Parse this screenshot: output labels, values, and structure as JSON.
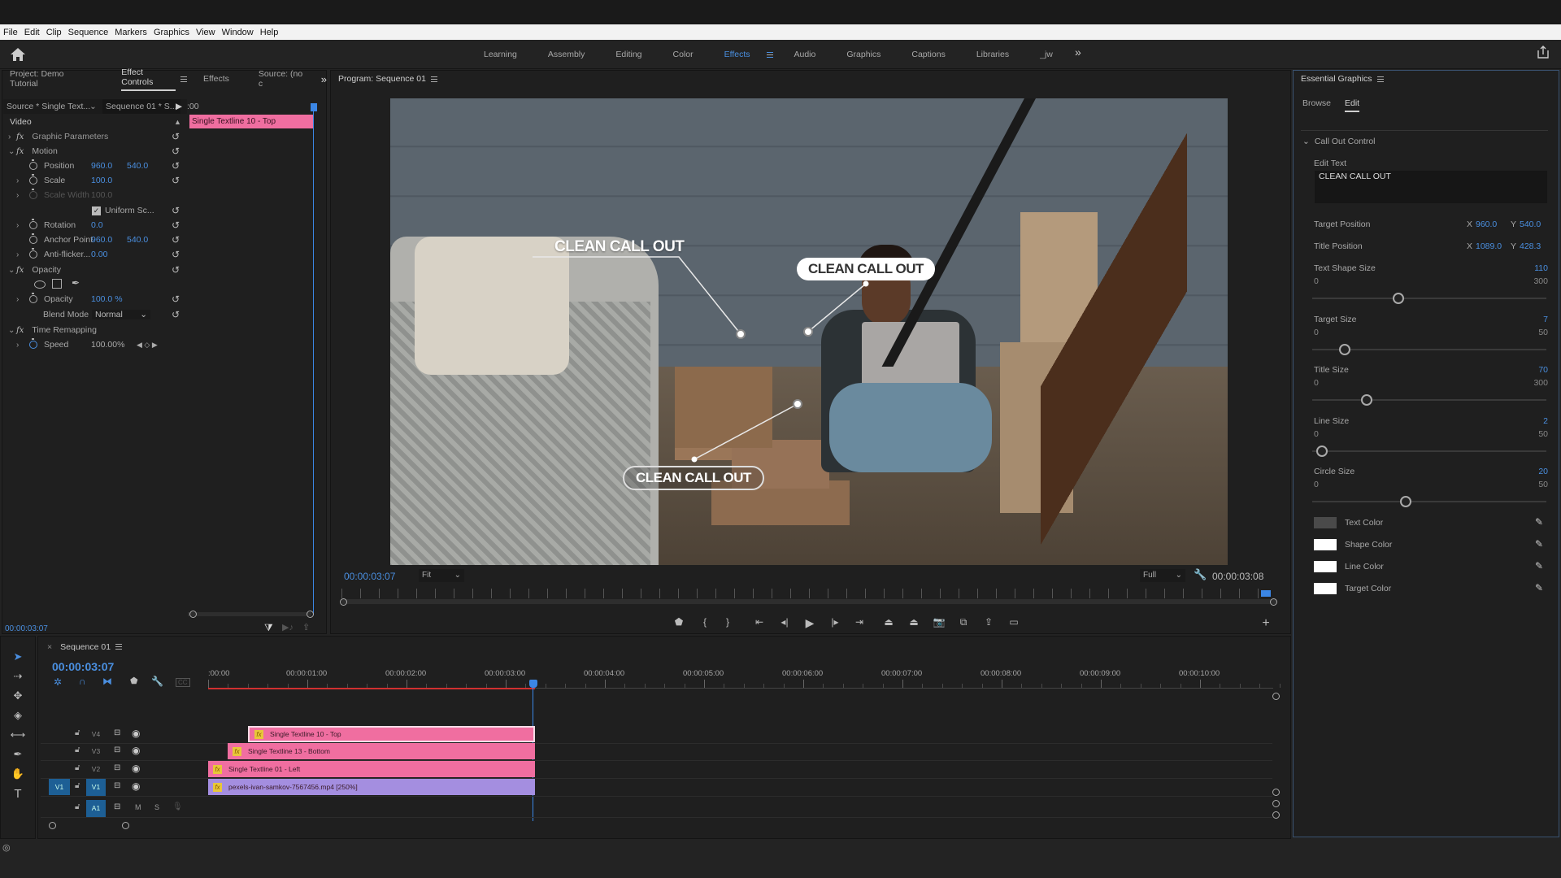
{
  "menu": [
    "File",
    "Edit",
    "Clip",
    "Sequence",
    "Markers",
    "Graphics",
    "View",
    "Window",
    "Help"
  ],
  "workspaces": {
    "items": [
      "Learning",
      "Assembly",
      "Editing",
      "Color",
      "Effects",
      "Audio",
      "Graphics",
      "Captions",
      "Libraries",
      "_jw"
    ],
    "active": "Effects",
    "more": "»"
  },
  "left_panel": {
    "tabs": [
      "Project: Demo Tutorial",
      "Effect Controls",
      "Effects",
      "Source: (no c"
    ],
    "active_tab": "Effect Controls",
    "more": "»",
    "source_label": "Source * Single Text...",
    "sequence_label": "Sequence 01 * S...",
    "mini_time": ":00",
    "clip_label": "Single Textline 10 - Top",
    "section": "Video",
    "properties": {
      "graphic_parameters": "Graphic Parameters",
      "motion": "Motion",
      "position_label": "Position",
      "position_x": "960.0",
      "position_y": "540.0",
      "scale_label": "Scale",
      "scale": "100.0",
      "scale_width_label": "Scale Width",
      "scale_width": "100.0",
      "uniform_scale_label": "Uniform Sc...",
      "uniform_scale_checked": true,
      "rotation_label": "Rotation",
      "rotation": "0.0",
      "anchor_label": "Anchor Point",
      "anchor_x": "960.0",
      "anchor_y": "540.0",
      "antiflicker_label": "Anti-flicker...",
      "antiflicker": "0.00",
      "opacity_section": "Opacity",
      "opacity_label": "Opacity",
      "opacity": "100.0 %",
      "blend_label": "Blend Mode",
      "blend": "Normal",
      "time_remap": "Time Remapping",
      "speed_label": "Speed",
      "speed": "100.00%"
    },
    "timecode": "00:00:03:07"
  },
  "program": {
    "title": "Program: Sequence 01",
    "timecode": "00:00:03:07",
    "fit": "Fit",
    "quality": "Full",
    "duration": "00:00:03:08",
    "callouts": [
      "CLEAN CALL OUT",
      "CLEAN CALL OUT",
      "CLEAN CALL OUT"
    ]
  },
  "essential_graphics": {
    "title": "Essential Graphics",
    "tabs": [
      "Browse",
      "Edit"
    ],
    "active_tab": "Edit",
    "section": "Call Out Control",
    "edit_text_label": "Edit Text",
    "edit_text_value": "CLEAN CALL OUT",
    "target_position": {
      "label": "Target Position",
      "x": "960.0",
      "y": "540.0"
    },
    "title_position": {
      "label": "Title Position",
      "x": "1089.0",
      "y": "428.3"
    },
    "sliders": [
      {
        "label": "Text Shape Size",
        "value": "110",
        "min": "0",
        "max": "300",
        "fraction": 0.367
      },
      {
        "label": "Target Size",
        "value": "7",
        "min": "0",
        "max": "50",
        "fraction": 0.14
      },
      {
        "label": "Title Size",
        "value": "70",
        "min": "0",
        "max": "300",
        "fraction": 0.233
      },
      {
        "label": "Line Size",
        "value": "2",
        "min": "0",
        "max": "50",
        "fraction": 0.04
      },
      {
        "label": "Circle Size",
        "value": "20",
        "min": "0",
        "max": "50",
        "fraction": 0.4
      }
    ],
    "colors": [
      {
        "label": "Text Color",
        "hex": "#4a4a4a"
      },
      {
        "label": "Shape Color",
        "hex": "#ffffff"
      },
      {
        "label": "Line Color",
        "hex": "#ffffff"
      },
      {
        "label": "Target Color",
        "hex": "#ffffff"
      }
    ]
  },
  "timeline": {
    "title": "Sequence 01",
    "timecode": "00:00:03:07",
    "ruler": [
      ":00:00",
      "00:00:01:00",
      "00:00:02:00",
      "00:00:03:00",
      "00:00:04:00",
      "00:00:05:00",
      "00:00:06:00",
      "00:00:07:00",
      "00:00:08:00",
      "00:00:09:00",
      "00:00:10:00"
    ],
    "tracks": [
      {
        "name": "V4"
      },
      {
        "name": "V3"
      },
      {
        "name": "V2"
      },
      {
        "name": "V1",
        "source": "V1"
      },
      {
        "name": "A1",
        "m": "M",
        "s": "S"
      }
    ],
    "clips": [
      {
        "track": "V4",
        "label": "Single Textline 10 - Top",
        "color": "#f06ea0"
      },
      {
        "track": "V3",
        "label": "Single Textline 13 - Bottom",
        "color": "#f06ea0"
      },
      {
        "track": "V2",
        "label": "Single Textline 01 - Left",
        "color": "#f06ea0"
      },
      {
        "track": "V1",
        "label": "pexels-ivan-samkov-7567456.mp4 [250%]",
        "color": "#a48ee0"
      }
    ]
  },
  "accent": "#4a8fe0"
}
